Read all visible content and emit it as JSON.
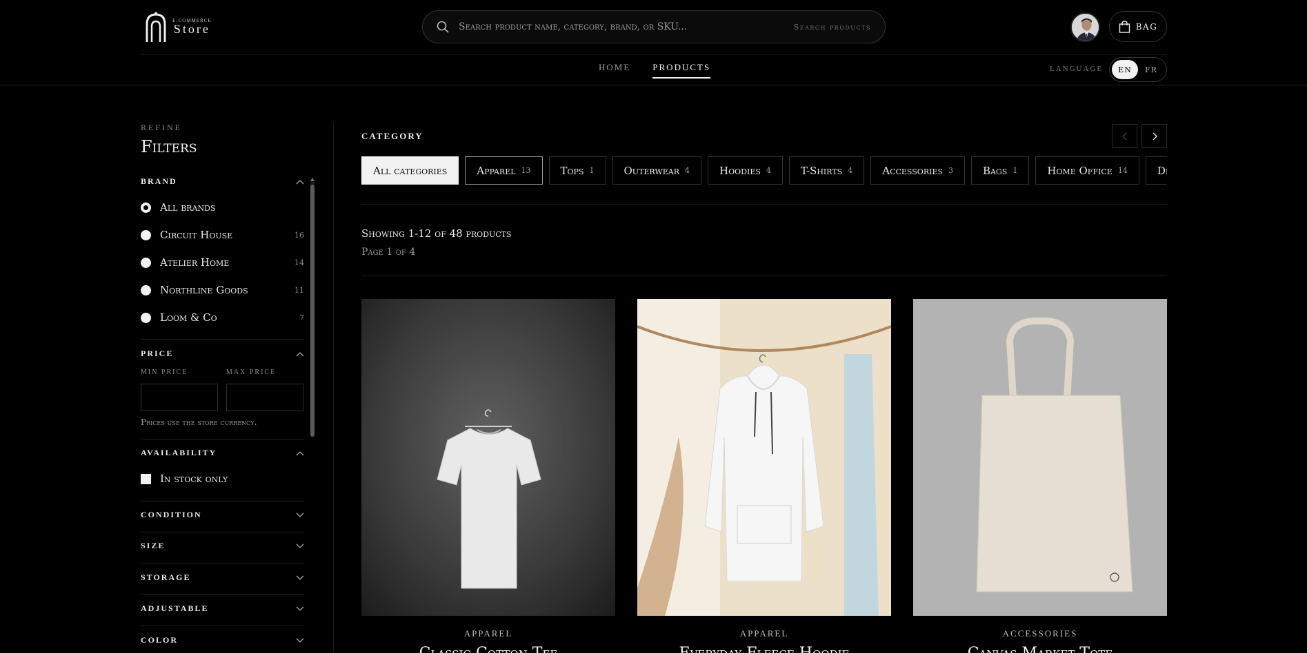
{
  "brand": {
    "logo_sub": "E-Commerce",
    "logo_main": "Store"
  },
  "search": {
    "placeholder": "Search product name, category, brand, or SKU...",
    "hint": "Search products"
  },
  "bag": {
    "label": "BAG"
  },
  "nav": {
    "items": [
      {
        "label": "HOME"
      },
      {
        "label": "PRODUCTS"
      }
    ]
  },
  "language": {
    "label": "LANGUAGE",
    "options": [
      "EN",
      "FR"
    ],
    "selected": "EN"
  },
  "sidebar": {
    "refine": "REFINE",
    "title": "Filters",
    "brand": {
      "title": "BRAND",
      "options": [
        {
          "label": "All brands",
          "count": ""
        },
        {
          "label": "Circuit House",
          "count": "16"
        },
        {
          "label": "Atelier Home",
          "count": "14"
        },
        {
          "label": "Northline Goods",
          "count": "11"
        },
        {
          "label": "Loom & Co",
          "count": "7"
        }
      ]
    },
    "price": {
      "title": "PRICE",
      "min_label": "MIN PRICE",
      "max_label": "MAX PRICE",
      "min_value": "",
      "max_value": "",
      "note": "Prices use the store currency."
    },
    "availability": {
      "title": "AVAILABILITY",
      "in_stock_label": "In stock only"
    },
    "collapsed_sections": [
      "CONDITION",
      "SIZE",
      "STORAGE",
      "ADJUSTABLE",
      "COLOR"
    ]
  },
  "category": {
    "title": "CATEGORY",
    "chips": [
      {
        "label": "All categories",
        "count": ""
      },
      {
        "label": "Apparel",
        "count": "13"
      },
      {
        "label": "Tops",
        "count": "1"
      },
      {
        "label": "Outerwear",
        "count": "4"
      },
      {
        "label": "Hoodies",
        "count": "4"
      },
      {
        "label": "T-Shirts",
        "count": "4"
      },
      {
        "label": "Accessories",
        "count": "3"
      },
      {
        "label": "Bags",
        "count": "1"
      },
      {
        "label": "Home Office",
        "count": "14"
      },
      {
        "label": "Desk",
        "count": ""
      }
    ]
  },
  "results": {
    "showing": "Showing 1-12 of 48 products",
    "page": "Page 1 of 4"
  },
  "products": [
    {
      "category": "APPAREL",
      "name": "Classic Cotton Tee"
    },
    {
      "category": "APPAREL",
      "name": "Everyday Fleece Hoodie"
    },
    {
      "category": "ACCESSORIES",
      "name": "Canvas Market Tote"
    }
  ]
}
